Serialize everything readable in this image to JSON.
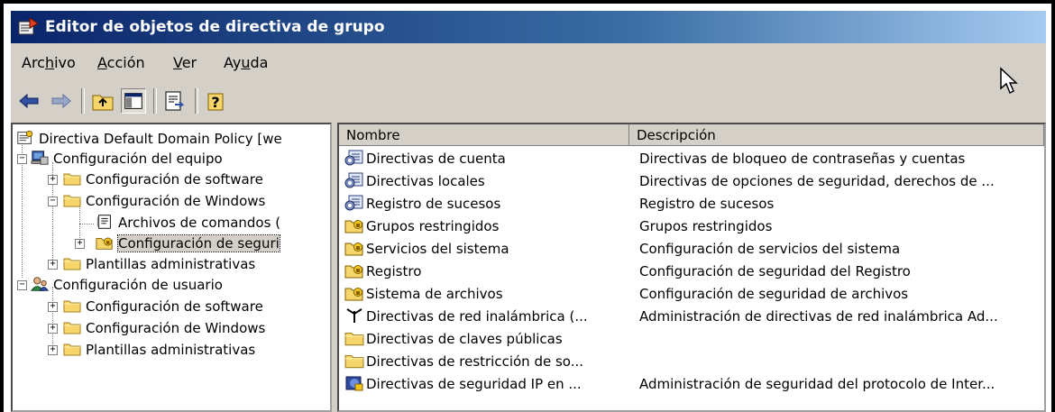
{
  "window": {
    "title": "Editor de objetos de directiva de grupo"
  },
  "menu": [
    {
      "label": "Archivo"
    },
    {
      "label": "Acción"
    },
    {
      "label": "Ver"
    },
    {
      "label": "Ayuda"
    }
  ],
  "toolbar": {
    "back_icon": "back-arrow-icon",
    "forward_icon": "forward-arrow-icon",
    "up_icon": "up-folder-icon",
    "show_hide_tree_icon": "show-hide-tree-icon",
    "export_icon": "export-list-icon",
    "help_icon": "help-icon"
  },
  "tree": {
    "root": "Directiva Default Domain Policy [we",
    "computer": "Configuración del equipo",
    "computer_software": "Configuración de software",
    "computer_windows": "Configuración de Windows",
    "scripts": "Archivos de comandos (",
    "security": "Configuración de seguri",
    "computer_admin": "Plantillas administrativas",
    "user": "Configuración de usuario",
    "user_software": "Configuración de software",
    "user_windows": "Configuración de Windows",
    "user_admin": "Plantillas administrativas"
  },
  "list": {
    "headers": {
      "name": "Nombre",
      "description": "Descripción"
    },
    "rows": [
      {
        "name": "Directivas de cuenta",
        "description": "Directivas de bloqueo de contraseñas y cuentas",
        "icon": "account-policy-icon"
      },
      {
        "name": "Directivas locales",
        "description": "Directivas de opciones de seguridad, derechos de ...",
        "icon": "local-policy-icon"
      },
      {
        "name": "Registro de sucesos",
        "description": "Registro de sucesos",
        "icon": "event-log-icon"
      },
      {
        "name": "Grupos restringidos",
        "description": "Grupos restringidos",
        "icon": "secure-folder-icon"
      },
      {
        "name": "Servicios del sistema",
        "description": "Configuración de servicios del sistema",
        "icon": "secure-folder-icon"
      },
      {
        "name": "Registro",
        "description": "Configuración de seguridad del Registro",
        "icon": "secure-folder-icon"
      },
      {
        "name": "Sistema de archivos",
        "description": "Configuración de seguridad de archivos",
        "icon": "secure-folder-icon"
      },
      {
        "name": "Directivas de red inalámbrica (...",
        "description": "Administración de directivas de red inalámbrica Ad...",
        "icon": "wireless-antenna-icon"
      },
      {
        "name": "Directivas de claves públicas",
        "description": "",
        "icon": "folder-icon"
      },
      {
        "name": "Directivas de restricción de so...",
        "description": "",
        "icon": "folder-icon"
      },
      {
        "name": "Directivas de seguridad IP en ...",
        "description": "Administración de seguridad del protocolo de Inter...",
        "icon": "ip-security-icon"
      }
    ]
  },
  "colors": {
    "title_dark": "#0a246a",
    "title_light": "#a6caf0",
    "chrome": "#d4d0c8",
    "folder": "#f6d66b"
  }
}
